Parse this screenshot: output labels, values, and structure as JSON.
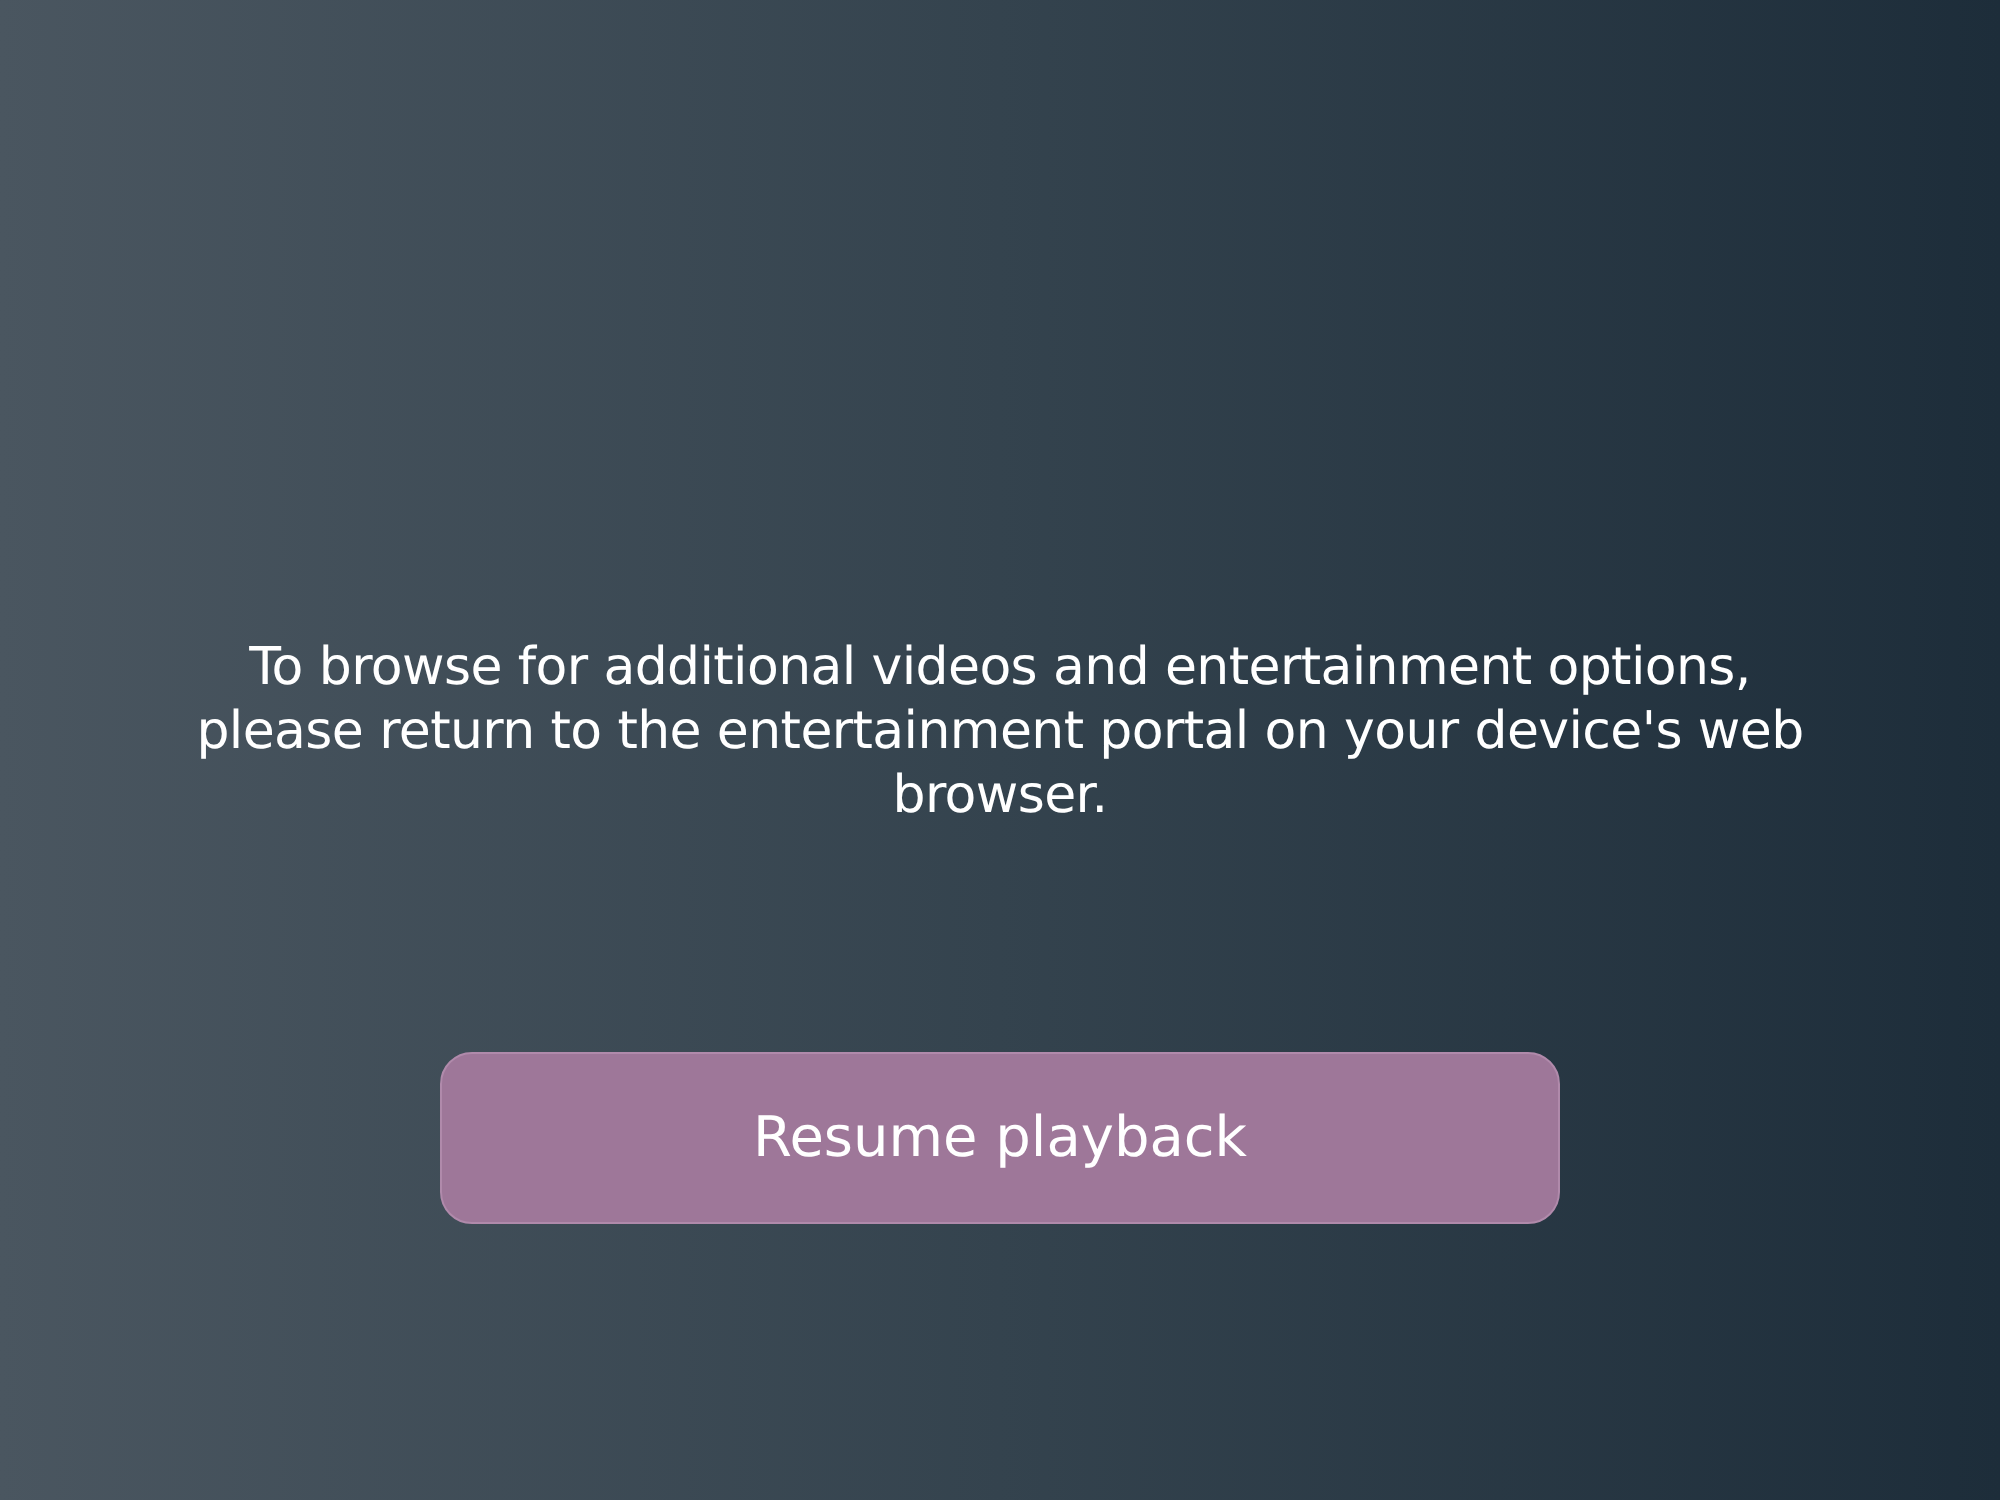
{
  "message": "To browse for additional videos and entertainment options, please return to the entertainment portal on your device's web browser.",
  "resume_button": {
    "label": "Resume playback"
  }
}
